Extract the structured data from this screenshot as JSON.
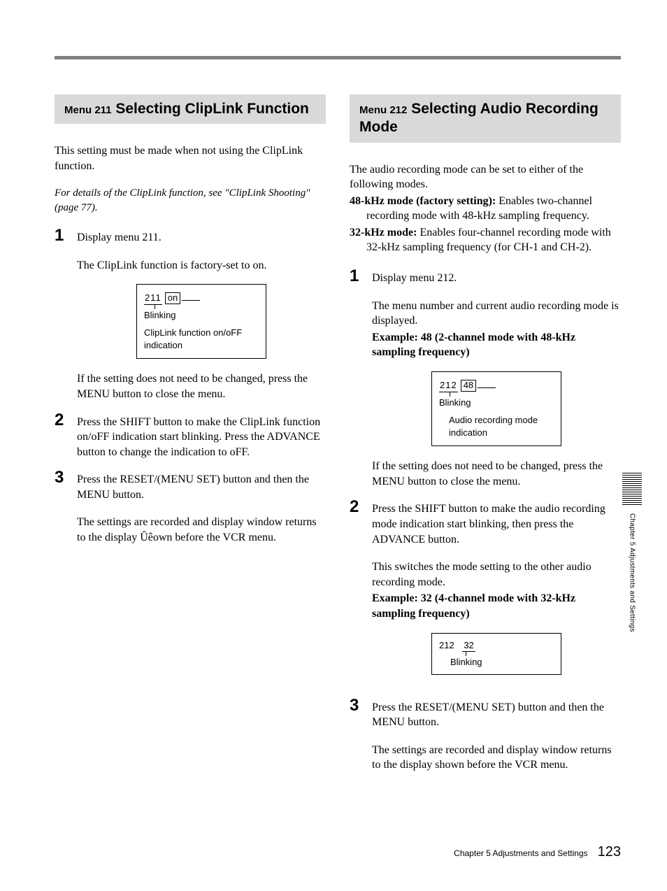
{
  "left": {
    "menu_pre": "Menu 211",
    "title": " Selecting ClipLink Function",
    "intro": "This setting must be made when not using the ClipLink function.",
    "crossref": "For details of the ClipLink function, see \"ClipLink Shooting\" (page 77).",
    "step1_num": "1",
    "step1_text": "Display menu 211.",
    "step1_sub": "The ClipLink function is factory-set to on.",
    "box1_num": "211",
    "box1_val": "on",
    "box1_blinking": "Blinking",
    "box1_label": "ClipLink function on/oFF indication",
    "step1_close": "If the setting does not need to be changed, press the MENU button to close the menu.",
    "step2_num": "2",
    "step2_text": "Press the SHIFT button to make the ClipLink function on/oFF indication start blinking. Press the ADVANCE button to change the indication to oFF.",
    "step3_num": "3",
    "step3_text": "Press the RESET/(MENU SET) button and then the MENU button.",
    "step3_sub": "The settings are recorded and display window returns to the display Ûêown before the VCR menu."
  },
  "right": {
    "menu_pre": "Menu 212",
    "title": " Selecting Audio Recording Mode",
    "intro": "The audio recording mode can be set to either of the following modes.",
    "mode48_label": "48-kHz mode (factory setting):",
    "mode48_body": " Enables two-channel recording mode with 48-kHz sampling frequency.",
    "mode32_label": "32-kHz mode:",
    "mode32_body": " Enables four-channel recording mode with 32-kHz sampling frequency (for CH-1 and CH-2).",
    "step1_num": "1",
    "step1_text": "Display menu 212.",
    "step1_sub": "The menu number and current audio recording mode is displayed.",
    "step1_ex_label": "Example: 48 (2-channel mode with 48-kHz sampling frequency)",
    "box1_num": "212",
    "box1_val": "48",
    "box1_blinking": "Blinking",
    "box1_label": "Audio recording mode indication",
    "step1_close": "If the setting does not need to be changed, press the MENU button to close the menu.",
    "step2_num": "2",
    "step2_text": "Press the SHIFT button to make the audio recording mode indication start blinking, then press the ADVANCE button.",
    "step2_sub": "This switches the mode setting to the other audio recording mode.",
    "step2_ex_label": "Example: 32 (4-channel mode with 32-kHz sampling frequency)",
    "box2_num": "212",
    "box2_val": "32",
    "box2_blinking": "Blinking",
    "step3_num": "3",
    "step3_text": "Press the RESET/(MENU SET) button and then the MENU button.",
    "step3_sub": "The settings are recorded and display window returns to the display shown before the VCR menu."
  },
  "side_tab": "Chapter 5 Adjustments and Settings",
  "footer_chapter": "Chapter 5    Adjustments and Settings",
  "footer_page": "123"
}
